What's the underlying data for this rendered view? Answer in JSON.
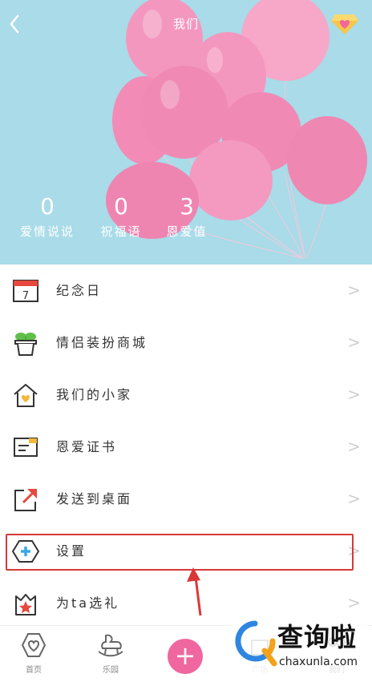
{
  "header": {
    "title": "我们",
    "back_icon": "chevron-left-icon",
    "vip_icon": "diamond-heart-icon",
    "background_color": "#a9dbe8",
    "balloon_color": "#f28bb6",
    "stats": [
      {
        "value": "0",
        "label": "爱情说说"
      },
      {
        "value": "0",
        "label": "祝福语"
      },
      {
        "value": "3",
        "label": "恩爱值"
      }
    ]
  },
  "menu": {
    "items": [
      {
        "label": "纪念日",
        "icon": "calendar-icon",
        "calendar_day": "7"
      },
      {
        "label": "情侣装扮商城",
        "icon": "plant-pot-icon"
      },
      {
        "label": "我们的小家",
        "icon": "home-heart-icon"
      },
      {
        "label": "恩爱证书",
        "icon": "certificate-icon"
      },
      {
        "label": "发送到桌面",
        "icon": "share-arrow-icon"
      },
      {
        "label": "设置",
        "icon": "settings-hexagon-icon"
      },
      {
        "label": "为ta选礼",
        "icon": "gift-star-icon"
      }
    ],
    "chevron": ">"
  },
  "nav": {
    "tabs": [
      {
        "label": "首页",
        "icon": "heart-frame-icon"
      },
      {
        "label": "乐园",
        "icon": "rocking-horse-icon"
      },
      {
        "label": "广场",
        "icon": "plaza-icon"
      },
      {
        "label": "我们",
        "icon": "couple-icon"
      }
    ],
    "add_label": "+",
    "accent": "#f0669e"
  },
  "watermark": {
    "text": "查询啦",
    "url_text": "chaxunla.com"
  },
  "annotation_color": "#d93838"
}
